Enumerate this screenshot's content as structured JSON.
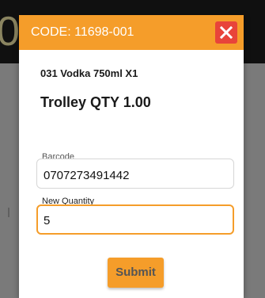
{
  "background": {
    "digit": "0"
  },
  "dialog": {
    "title": "CODE: 11698-001",
    "close_icon": "close-icon",
    "item_description": "031 Vodka 750ml X1",
    "trolley_qty": "Trolley QTY 1.00",
    "barcode": {
      "label": "Barcode",
      "value": "0707273491442"
    },
    "new_quantity": {
      "label": "New Quantity",
      "value": "5"
    },
    "submit_label": "Submit"
  },
  "colors": {
    "accent": "#f59d2a",
    "close_button": "#e8443a",
    "overlay": "#777777"
  }
}
